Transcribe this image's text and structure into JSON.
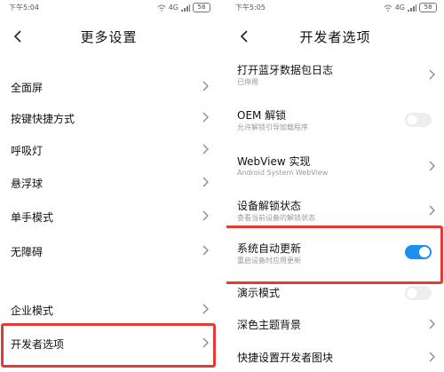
{
  "colors": {
    "highlight": "#e53935",
    "toggle_on": "#1f8ef1",
    "toggle_off": "#eeeeee",
    "subtext": "#9a9a9a"
  },
  "left_screen": {
    "status_bar": {
      "time": "下午5:04",
      "network": "4G",
      "battery": "58"
    },
    "title": "更多设置",
    "back_icon": "chevron-left-icon",
    "items": [
      {
        "label": "全面屏",
        "action": "chevron-right-icon"
      },
      {
        "label": "按键快捷方式",
        "action": "chevron-right-icon"
      },
      {
        "label": "呼吸灯",
        "action": "chevron-right-icon"
      },
      {
        "label": "悬浮球",
        "action": "chevron-right-icon"
      },
      {
        "label": "单手模式",
        "action": "chevron-right-icon"
      },
      {
        "label": "无障碍",
        "action": "chevron-right-icon"
      },
      {
        "label": "企业模式",
        "action": "chevron-right-icon"
      },
      {
        "label": "开发者选项",
        "action": "chevron-right-icon",
        "highlighted": true
      }
    ]
  },
  "right_screen": {
    "status_bar": {
      "time": "下午5:05",
      "network": "4G",
      "battery": "58"
    },
    "title": "开发者选项",
    "back_icon": "chevron-left-icon",
    "items": [
      {
        "label": "打开蓝牙数据包日志",
        "sublabel": "已停用",
        "action": "chevron-right-icon"
      },
      {
        "label": "OEM 解锁",
        "sublabel": "允许解锁引导加载程序",
        "action": "toggle",
        "toggle_on": false
      },
      {
        "label": "WebView 实现",
        "sublabel": "Android System WebView",
        "action": "chevron-right-icon"
      },
      {
        "label": "设备解锁状态",
        "sublabel": "查看当前设备的解锁状态",
        "action": "chevron-right-icon"
      },
      {
        "label": "系统自动更新",
        "sublabel": "重启设备时应用更新",
        "action": "toggle",
        "toggle_on": true,
        "highlighted": true
      },
      {
        "label": "演示模式",
        "action": "toggle",
        "toggle_on": false
      },
      {
        "label": "深色主题背景",
        "action": "chevron-right-icon"
      },
      {
        "label": "快捷设置开发者图块",
        "action": "chevron-right-icon"
      }
    ]
  }
}
